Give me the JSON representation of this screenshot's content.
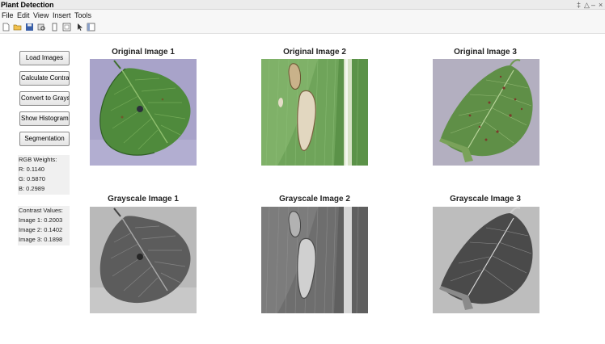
{
  "window": {
    "title": "Plant Detection",
    "controls": [
      "‡",
      "△",
      "–",
      "×"
    ]
  },
  "menu": [
    "File",
    "Edit",
    "View",
    "Insert",
    "Tools"
  ],
  "toolbar": [
    "new-file-icon",
    "open-folder-icon",
    "save-icon",
    "print-preview-icon",
    "copy-icon",
    "figure-icon",
    "pointer-icon",
    "panel-icon"
  ],
  "buttons": {
    "load": "Load Images",
    "contrast": "Calculate Contrast",
    "grayscale": "Convert to Grayscale",
    "histogram": "Show Histogram",
    "segmentation": "Segmentation"
  },
  "rgb": {
    "title": "RGB Weights:",
    "r": "R: 0.1140",
    "g": "G: 0.5870",
    "b": "B: 0.2989"
  },
  "contrast": {
    "title": "Contrast Values:",
    "img1": "Image 1: 0.2003",
    "img2": "Image 2: 0.1402",
    "img3": "Image 3: 0.1898"
  },
  "images": {
    "orig1": "Original Image 1",
    "orig2": "Original Image 2",
    "orig3": "Original Image 3",
    "gray1": "Grayscale Image 1",
    "gray2": "Grayscale Image 2",
    "gray3": "Grayscale Image 3"
  },
  "colors": {
    "leaf_green": "#4f8a3c",
    "leaf_background": "#a8a3c9",
    "corn_green": "#5d9a4a",
    "potato_background": "#b3afc0"
  }
}
